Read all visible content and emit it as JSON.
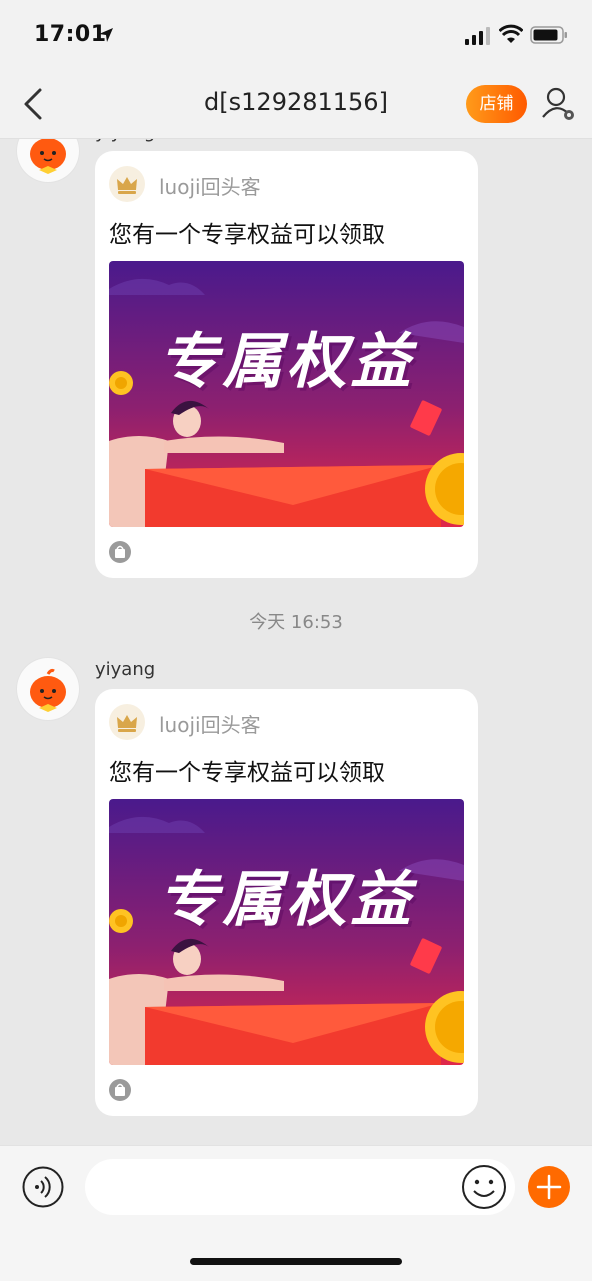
{
  "status_bar": {
    "time": "17:01"
  },
  "nav": {
    "title": "d[s129281156]",
    "shop_label": "店铺"
  },
  "messages": [
    {
      "sender": "yiyang",
      "card": {
        "source": "luoji回头客",
        "text": "您有一个专享权益可以领取",
        "banner_title": "专属权益"
      }
    },
    {
      "sender": "yiyang",
      "card": {
        "source": "luoji回头客",
        "text": "您有一个专享权益可以领取",
        "banner_title": "专属权益"
      }
    }
  ],
  "timestamp": "今天 16:53",
  "input": {
    "value": "",
    "placeholder": ""
  },
  "colors": {
    "accent": "#ff6a00",
    "banner_top": "#4a1a8c",
    "banner_bottom": "#e0284a",
    "envelope": "#f23a2e"
  }
}
